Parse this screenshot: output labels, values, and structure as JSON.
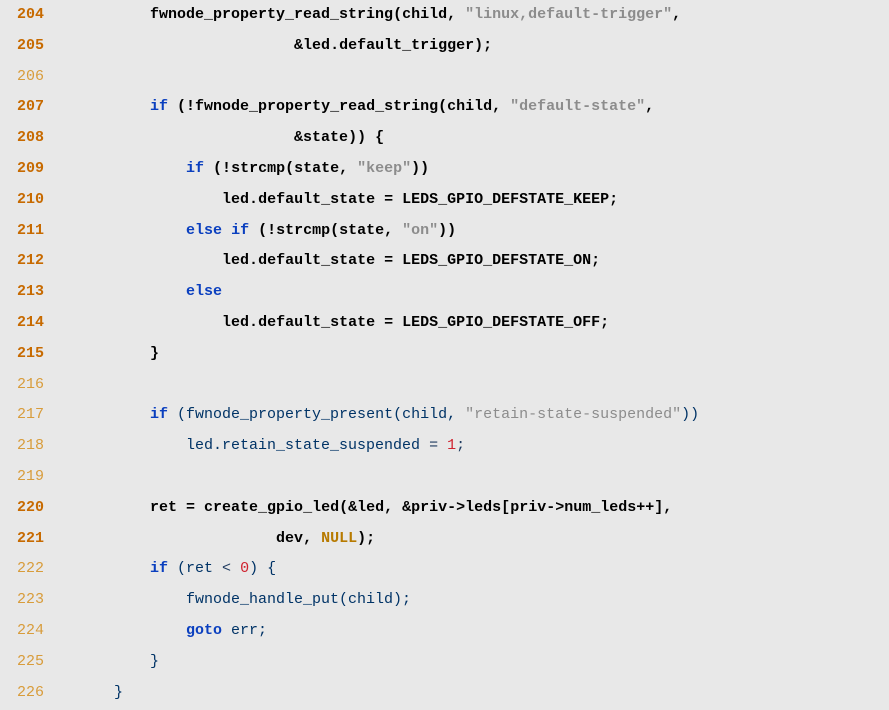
{
  "lines": [
    {
      "n": "204",
      "weight": "bold",
      "segments": [
        {
          "t": "        ",
          "c": ""
        },
        {
          "t": "fwnode_property_read_string",
          "c": ""
        },
        {
          "t": "(",
          "c": ""
        },
        {
          "t": "child",
          "c": ""
        },
        {
          "t": ", ",
          "c": ""
        },
        {
          "t": "\"linux,default-trigger\"",
          "c": "str"
        },
        {
          "t": ",",
          "c": ""
        }
      ]
    },
    {
      "n": "205",
      "weight": "bold",
      "segments": [
        {
          "t": "                        &",
          "c": ""
        },
        {
          "t": "led",
          "c": ""
        },
        {
          "t": ".",
          "c": ""
        },
        {
          "t": "default_trigger",
          "c": ""
        },
        {
          "t": ");",
          "c": ""
        }
      ]
    },
    {
      "n": "206",
      "weight": "light",
      "segments": [
        {
          "t": "",
          "c": ""
        }
      ]
    },
    {
      "n": "207",
      "weight": "bold",
      "segments": [
        {
          "t": "        ",
          "c": ""
        },
        {
          "t": "if",
          "c": "kw"
        },
        {
          "t": " (!",
          "c": ""
        },
        {
          "t": "fwnode_property_read_string",
          "c": ""
        },
        {
          "t": "(",
          "c": ""
        },
        {
          "t": "child",
          "c": ""
        },
        {
          "t": ", ",
          "c": ""
        },
        {
          "t": "\"default-state\"",
          "c": "str"
        },
        {
          "t": ",",
          "c": ""
        }
      ]
    },
    {
      "n": "208",
      "weight": "bold",
      "segments": [
        {
          "t": "                        &",
          "c": ""
        },
        {
          "t": "state",
          "c": ""
        },
        {
          "t": ")) {",
          "c": ""
        }
      ]
    },
    {
      "n": "209",
      "weight": "bold",
      "segments": [
        {
          "t": "            ",
          "c": ""
        },
        {
          "t": "if",
          "c": "kw"
        },
        {
          "t": " (!",
          "c": ""
        },
        {
          "t": "strcmp",
          "c": ""
        },
        {
          "t": "(",
          "c": ""
        },
        {
          "t": "state",
          "c": ""
        },
        {
          "t": ", ",
          "c": ""
        },
        {
          "t": "\"keep\"",
          "c": "str"
        },
        {
          "t": "))",
          "c": ""
        }
      ]
    },
    {
      "n": "210",
      "weight": "bold",
      "segments": [
        {
          "t": "                ",
          "c": ""
        },
        {
          "t": "led",
          "c": ""
        },
        {
          "t": ".",
          "c": ""
        },
        {
          "t": "default_state",
          "c": ""
        },
        {
          "t": " = ",
          "c": ""
        },
        {
          "t": "LEDS_GPIO_DEFSTATE_KEEP",
          "c": ""
        },
        {
          "t": ";",
          "c": ""
        }
      ]
    },
    {
      "n": "211",
      "weight": "bold",
      "segments": [
        {
          "t": "            ",
          "c": ""
        },
        {
          "t": "else",
          "c": "kw"
        },
        {
          "t": " ",
          "c": ""
        },
        {
          "t": "if",
          "c": "kw"
        },
        {
          "t": " (!",
          "c": ""
        },
        {
          "t": "strcmp",
          "c": ""
        },
        {
          "t": "(",
          "c": ""
        },
        {
          "t": "state",
          "c": ""
        },
        {
          "t": ", ",
          "c": ""
        },
        {
          "t": "\"on\"",
          "c": "str"
        },
        {
          "t": "))",
          "c": ""
        }
      ]
    },
    {
      "n": "212",
      "weight": "bold",
      "segments": [
        {
          "t": "                ",
          "c": ""
        },
        {
          "t": "led",
          "c": ""
        },
        {
          "t": ".",
          "c": ""
        },
        {
          "t": "default_state",
          "c": ""
        },
        {
          "t": " = ",
          "c": ""
        },
        {
          "t": "LEDS_GPIO_DEFSTATE_ON",
          "c": ""
        },
        {
          "t": ";",
          "c": ""
        }
      ]
    },
    {
      "n": "213",
      "weight": "bold",
      "segments": [
        {
          "t": "            ",
          "c": ""
        },
        {
          "t": "else",
          "c": "kw"
        }
      ]
    },
    {
      "n": "214",
      "weight": "bold",
      "segments": [
        {
          "t": "                ",
          "c": ""
        },
        {
          "t": "led",
          "c": ""
        },
        {
          "t": ".",
          "c": ""
        },
        {
          "t": "default_state",
          "c": ""
        },
        {
          "t": " = ",
          "c": ""
        },
        {
          "t": "LEDS_GPIO_DEFSTATE_OFF",
          "c": ""
        },
        {
          "t": ";",
          "c": ""
        }
      ]
    },
    {
      "n": "215",
      "weight": "bold",
      "segments": [
        {
          "t": "        }",
          "c": ""
        }
      ]
    },
    {
      "n": "216",
      "weight": "light",
      "segments": [
        {
          "t": "",
          "c": ""
        }
      ]
    },
    {
      "n": "217",
      "weight": "light",
      "segments": [
        {
          "t": "        ",
          "c": ""
        },
        {
          "t": "if",
          "c": "kw"
        },
        {
          "t": " (fwnode_property_present(child, ",
          "c": "blue"
        },
        {
          "t": "\"retain-state-suspended\"",
          "c": "str"
        },
        {
          "t": "))",
          "c": "blue"
        }
      ]
    },
    {
      "n": "218",
      "weight": "light",
      "segments": [
        {
          "t": "            led.retain_state_suspended ",
          "c": "blue"
        },
        {
          "t": "=",
          "c": ""
        },
        {
          "t": " ",
          "c": ""
        },
        {
          "t": "1",
          "c": "num"
        },
        {
          "t": ";",
          "c": ""
        }
      ]
    },
    {
      "n": "219",
      "weight": "light",
      "segments": [
        {
          "t": "",
          "c": ""
        }
      ]
    },
    {
      "n": "220",
      "weight": "bold",
      "segments": [
        {
          "t": "        ",
          "c": ""
        },
        {
          "t": "ret",
          "c": ""
        },
        {
          "t": " = ",
          "c": ""
        },
        {
          "t": "create_gpio_led",
          "c": ""
        },
        {
          "t": "(&",
          "c": ""
        },
        {
          "t": "led",
          "c": ""
        },
        {
          "t": ", &",
          "c": ""
        },
        {
          "t": "priv",
          "c": ""
        },
        {
          "t": "->",
          "c": ""
        },
        {
          "t": "leds",
          "c": ""
        },
        {
          "t": "[",
          "c": ""
        },
        {
          "t": "priv",
          "c": ""
        },
        {
          "t": "->",
          "c": ""
        },
        {
          "t": "num_leds",
          "c": ""
        },
        {
          "t": "++],",
          "c": ""
        }
      ]
    },
    {
      "n": "221",
      "weight": "bold",
      "segments": [
        {
          "t": "                      ",
          "c": ""
        },
        {
          "t": "dev",
          "c": ""
        },
        {
          "t": ", ",
          "c": ""
        },
        {
          "t": "NULL",
          "c": "nul"
        },
        {
          "t": ");",
          "c": ""
        }
      ]
    },
    {
      "n": "222",
      "weight": "light",
      "segments": [
        {
          "t": "        ",
          "c": ""
        },
        {
          "t": "if",
          "c": "kw"
        },
        {
          "t": " (ret ",
          "c": "blue"
        },
        {
          "t": "<",
          "c": ""
        },
        {
          "t": " ",
          "c": ""
        },
        {
          "t": "0",
          "c": "num"
        },
        {
          "t": ") {",
          "c": "blue"
        }
      ]
    },
    {
      "n": "223",
      "weight": "light",
      "segments": [
        {
          "t": "            fwnode_handle_put(child);",
          "c": "blue"
        }
      ]
    },
    {
      "n": "224",
      "weight": "light",
      "segments": [
        {
          "t": "            ",
          "c": ""
        },
        {
          "t": "goto",
          "c": "kw"
        },
        {
          "t": " err;",
          "c": "blue"
        }
      ]
    },
    {
      "n": "225",
      "weight": "light",
      "segments": [
        {
          "t": "        }",
          "c": "blue"
        }
      ]
    },
    {
      "n": "226",
      "weight": "light",
      "segments": [
        {
          "t": "    }",
          "c": "blue"
        }
      ]
    }
  ]
}
